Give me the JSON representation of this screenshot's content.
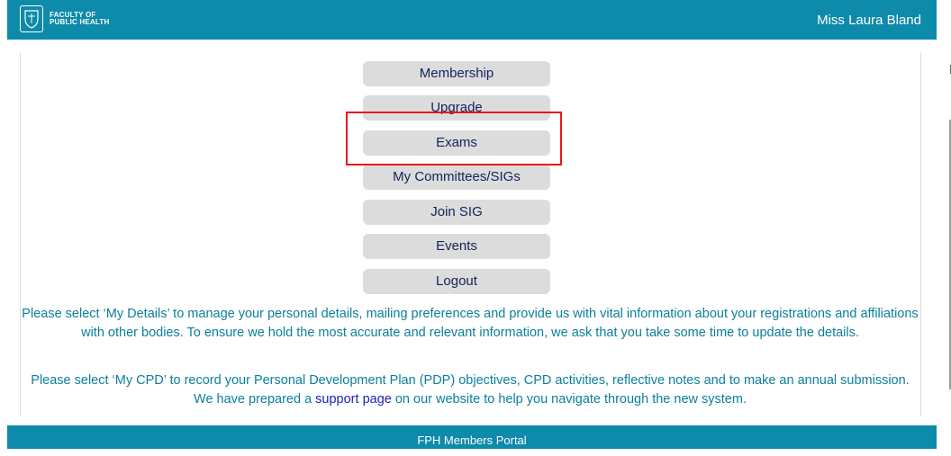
{
  "header": {
    "logo_line1": "FACULTY OF",
    "logo_line2": "PUBLIC HEALTH",
    "user_name": "Miss Laura Bland"
  },
  "menu": {
    "items": [
      {
        "label": "Membership"
      },
      {
        "label": "Upgrade"
      },
      {
        "label": "Exams"
      },
      {
        "label": "My Committees/SIGs"
      },
      {
        "label": "Join SIG"
      },
      {
        "label": "Events"
      },
      {
        "label": "Logout"
      }
    ]
  },
  "content": {
    "para1": "Please select ‘My Details’ to manage your personal details, mailing preferences and provide us with vital information about your registrations and affiliations with other bodies. To ensure we hold the most accurate and relevant information, we ask that you take some time to update the details.",
    "para2_before": "Please select ‘My CPD’ to record your Personal Development Plan (PDP) objectives, CPD activities, reflective notes and to make an annual submission. We have prepared a ",
    "para2_link": "support page",
    "para2_after": " on our website to help you navigate through the new system."
  },
  "footer": {
    "label": "FPH Members Portal"
  },
  "colors": {
    "brand": "#0e8aaa",
    "button_bg": "#dcdcdc",
    "button_text": "#13235b",
    "highlight": "#e31a1a",
    "text": "#0b7f9c"
  }
}
